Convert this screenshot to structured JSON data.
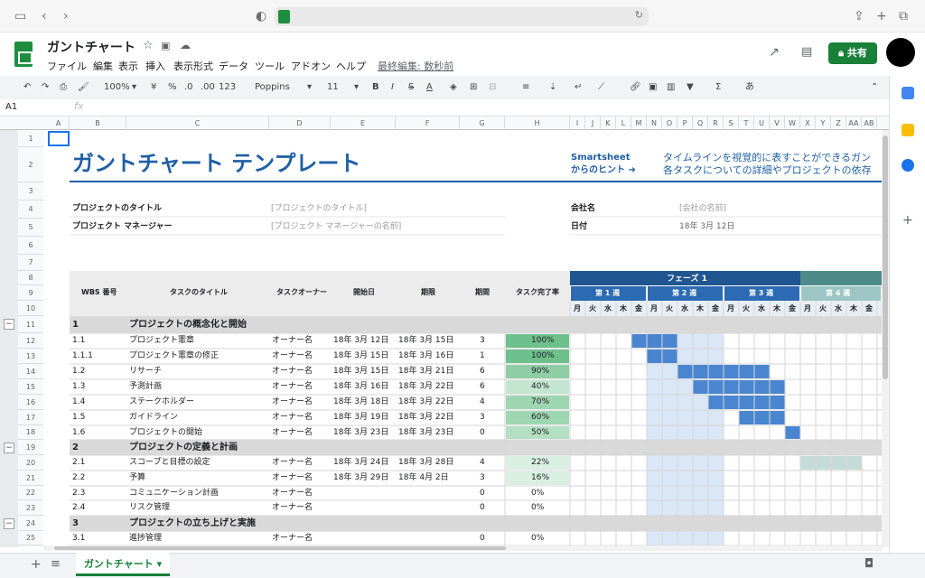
{
  "doc": {
    "title": "ガントチャート",
    "last_edit": "最終編集: 数秒前",
    "share_label": "共有"
  },
  "menu": [
    "ファイル",
    "編集",
    "表示",
    "挿入",
    "表示形式",
    "データ",
    "ツール",
    "アドオン",
    "ヘルプ"
  ],
  "toolbar": {
    "zoom": "100%",
    "currency": "¥",
    "percent": "%",
    "dec0": ".0",
    "dec00": ".00",
    "format123": "123",
    "font": "Poppins",
    "size": "11",
    "input_method": "あ"
  },
  "formula": {
    "cell_ref": "A1",
    "fx": "fx"
  },
  "columns": [
    "A",
    "B",
    "C",
    "D",
    "E",
    "F",
    "G",
    "H",
    "I",
    "J",
    "K",
    "L",
    "M",
    "N",
    "O",
    "P",
    "Q",
    "R",
    "S",
    "T",
    "U",
    "V",
    "W",
    "X",
    "Y",
    "Z",
    "AA",
    "AB"
  ],
  "rows": [
    "1",
    "2",
    "3",
    "4",
    "5",
    "6",
    "7",
    "8",
    "9",
    "10",
    "11",
    "12",
    "13",
    "14",
    "15",
    "16",
    "17",
    "18",
    "19",
    "20",
    "21",
    "22",
    "23",
    "24",
    "25"
  ],
  "sheet": {
    "title": "ガントチャート テンプレート",
    "hint_line1": "Smartsheet",
    "hint_line2": "からのヒント ➜",
    "hint_text1": "タイムラインを視覚的に表すことができるガン",
    "hint_text2": "各タスクについての詳細やプロジェクトの依存",
    "project_title_label": "プロジェクトのタイトル",
    "project_title_value": "[プロジェクトのタイトル]",
    "manager_label": "プロジェクト マネージャー",
    "manager_value": "[プロジェクト マネージャーの名前]",
    "company_label": "会社名",
    "company_value": "[会社の名前]",
    "date_label": "日付",
    "date_value": "18年 3月 12日",
    "headers": {
      "wbs": "WBS 番号",
      "task": "タスクのタイトル",
      "owner": "タスクオーナー",
      "start": "開始日",
      "end": "期限",
      "duration": "期間",
      "complete": "タスク完了率"
    },
    "phase1": "フェーズ 1",
    "weeks": [
      "第 1 週",
      "第 2 週",
      "第 3 週",
      "第 4 週"
    ],
    "days": [
      "月",
      "火",
      "水",
      "木",
      "金"
    ]
  },
  "tasks": [
    {
      "wbs": "1",
      "title": "プロジェクトの概念化と開始",
      "section": true
    },
    {
      "wbs": "1.1",
      "title": "プロジェクト憲章",
      "owner": "オーナー名",
      "start": "18年 3月 12日",
      "end": "18年 3月 15日",
      "dur": "3",
      "pct": "100%",
      "fill": 1.0,
      "bar_start": 4,
      "bar_len": 3
    },
    {
      "wbs": "1.1.1",
      "title": "プロジェクト憲章の修正",
      "owner": "オーナー名",
      "start": "18年 3月 15日",
      "end": "18年 3月 16日",
      "dur": "1",
      "pct": "100%",
      "fill": 1.0,
      "bar_start": 5,
      "bar_len": 2
    },
    {
      "wbs": "1.2",
      "title": "リサーチ",
      "owner": "オーナー名",
      "start": "18年 3月 15日",
      "end": "18年 3月 21日",
      "dur": "6",
      "pct": "90%",
      "fill": 0.9,
      "bar_start": 7,
      "bar_len": 6
    },
    {
      "wbs": "1.3",
      "title": "予測計画",
      "owner": "オーナー名",
      "start": "18年 3月 16日",
      "end": "18年 3月 22日",
      "dur": "6",
      "pct": "40%",
      "fill": 0.4,
      "bar_start": 8,
      "bar_len": 6
    },
    {
      "wbs": "1.4",
      "title": "ステークホルダー",
      "owner": "オーナー名",
      "start": "18年 3月 18日",
      "end": "18年 3月 22日",
      "dur": "4",
      "pct": "70%",
      "fill": 0.7,
      "bar_start": 9,
      "bar_len": 5
    },
    {
      "wbs": "1.5",
      "title": "ガイドライン",
      "owner": "オーナー名",
      "start": "18年 3月 19日",
      "end": "18年 3月 22日",
      "dur": "3",
      "pct": "60%",
      "fill": 0.6,
      "bar_start": 11,
      "bar_len": 3
    },
    {
      "wbs": "1.6",
      "title": "プロジェクトの開始",
      "owner": "オーナー名",
      "start": "18年 3月 23日",
      "end": "18年 3月 23日",
      "dur": "0",
      "pct": "50%",
      "fill": 0.5,
      "bar_start": 14,
      "bar_len": 1
    },
    {
      "wbs": "2",
      "title": "プロジェクトの定義と計画",
      "section": true
    },
    {
      "wbs": "2.1",
      "title": "スコープと目標の設定",
      "owner": "オーナー名",
      "start": "18年 3月 24日",
      "end": "18年 3月 28日",
      "dur": "4",
      "pct": "22%",
      "fill": 0.22,
      "bar_start": 15,
      "bar_len": 4,
      "light": true
    },
    {
      "wbs": "2.2",
      "title": "予算",
      "owner": "オーナー名",
      "start": "18年 3月 29日",
      "end": "18年 4月 2日",
      "dur": "3",
      "pct": "16%",
      "fill": 0.16,
      "bar_start": 19,
      "bar_len": 2,
      "light": true
    },
    {
      "wbs": "2.3",
      "title": "コミュニケーション計画",
      "owner": "オーナー名",
      "start": "",
      "end": "",
      "dur": "0",
      "pct": "0%",
      "fill": 0
    },
    {
      "wbs": "2.4",
      "title": "リスク管理",
      "owner": "オーナー名",
      "start": "",
      "end": "",
      "dur": "0",
      "pct": "0%",
      "fill": 0
    },
    {
      "wbs": "3",
      "title": "プロジェクトの立ち上げと実施",
      "section": true
    },
    {
      "wbs": "3.1",
      "title": "進捗管理",
      "owner": "オーナー名",
      "start": "",
      "end": "",
      "dur": "0",
      "pct": "0%",
      "fill": 0
    }
  ],
  "colors": {
    "accent": "#1f5fa6",
    "bar": "#4a86d0",
    "bar_light": "#c5dbd8",
    "section_bg": "#d9d9d9",
    "pct_full": "#6dc08c",
    "pct_mid": "#a8dcb9",
    "phase_dark": "#1f5591",
    "phase2": "#4f8a8b"
  }
}
